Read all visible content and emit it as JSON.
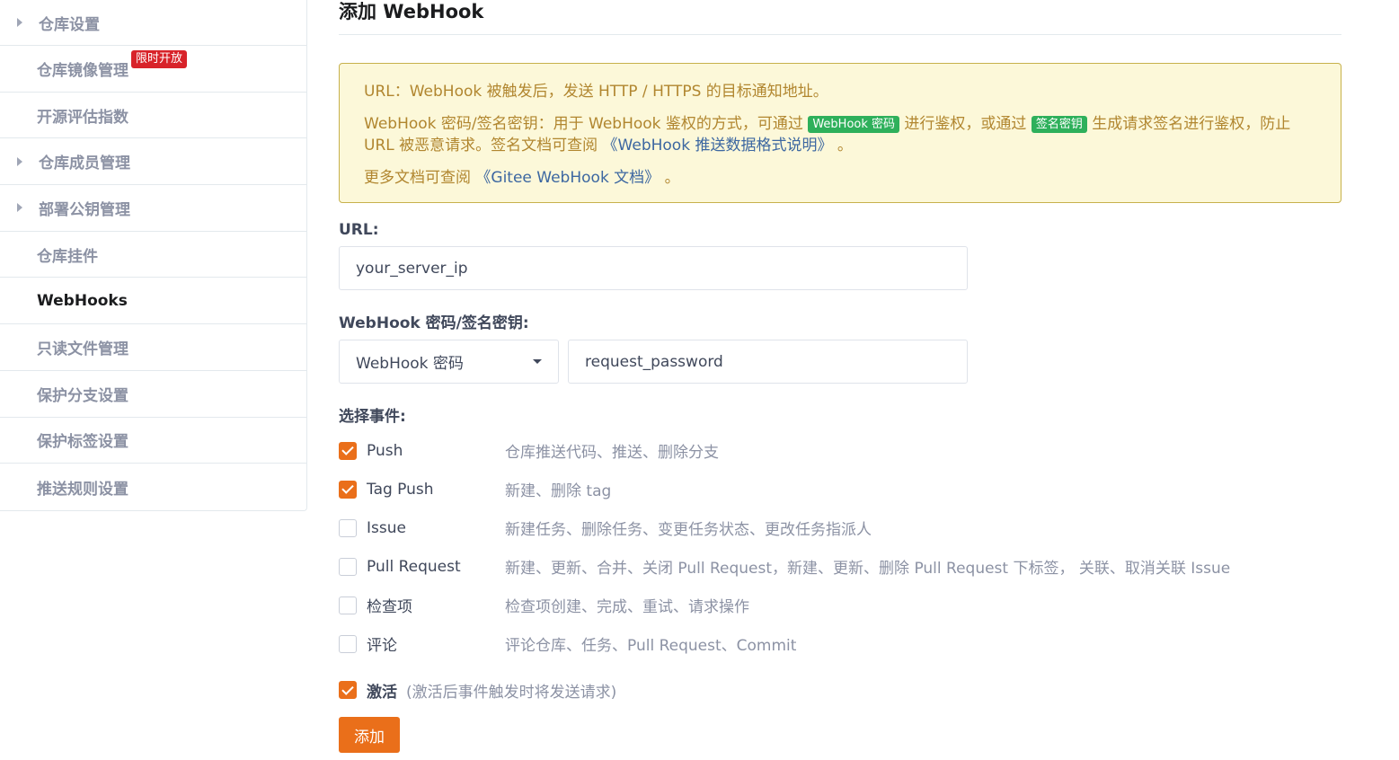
{
  "sidebar": {
    "items": [
      {
        "label": "仓库设置",
        "caret": true
      },
      {
        "label": "仓库镜像管理",
        "badge": "限时开放"
      },
      {
        "label": "开源评估指数"
      },
      {
        "label": "仓库成员管理",
        "caret": true
      },
      {
        "label": "部署公钥管理",
        "caret": true
      },
      {
        "label": "仓库挂件"
      },
      {
        "label": "WebHooks",
        "active": true
      },
      {
        "label": "只读文件管理"
      },
      {
        "label": "保护分支设置"
      },
      {
        "label": "保护标签设置"
      },
      {
        "label": "推送规则设置"
      }
    ]
  },
  "main": {
    "title": "添加 WebHook",
    "notice": {
      "line1": "URL：WebHook 被触发后，发送 HTTP / HTTPS 的目标通知地址。",
      "line2_a": "WebHook 密码/签名密钥：用于 WebHook 鉴权的方式，可通过 ",
      "tag_password": "WebHook 密码",
      "line2_b": " 进行鉴权，或通过 ",
      "tag_secret": "签名密钥",
      "line2_c": " 生成请求签名进行鉴权，防止 URL 被恶意请求。签名文档可查阅 ",
      "link_format": "《WebHook 推送数据格式说明》",
      "line2_d": " 。",
      "line3_a": "更多文档可查阅 ",
      "link_docs": "《Gitee WebHook 文档》",
      "line3_b": " 。"
    },
    "url_label": "URL:",
    "url_value": "your_server_ip",
    "secret_label": "WebHook 密码/签名密钥:",
    "secret_type": "WebHook 密码",
    "secret_value": "request_password",
    "events_label": "选择事件:",
    "events": [
      {
        "name": "Push",
        "desc": "仓库推送代码、推送、删除分支",
        "checked": true
      },
      {
        "name": "Tag Push",
        "desc": "新建、删除 tag",
        "checked": true
      },
      {
        "name": "Issue",
        "desc": "新建任务、删除任务、变更任务状态、更改任务指派人",
        "checked": false
      },
      {
        "name": "Pull Request",
        "desc": "新建、更新、合并、关闭 Pull Request，新建、更新、删除 Pull Request 下标签， 关联、取消关联 Issue",
        "checked": false
      },
      {
        "name": "检查项",
        "desc": "检查项创建、完成、重试、请求操作",
        "checked": false
      },
      {
        "name": "评论",
        "desc": "评论仓库、任务、Pull Request、Commit",
        "checked": false
      }
    ],
    "activate_label": "激活",
    "activate_hint": "(激活后事件触发时将发送请求)",
    "activate_checked": true,
    "submit_label": "添加"
  },
  "colors": {
    "accent": "#ea6f1a",
    "badge_red": "#d8232a",
    "tag_green": "#2eb05b",
    "notice_bg": "#fcf8d9",
    "notice_text": "#b1862f",
    "link": "#3c67a1"
  }
}
